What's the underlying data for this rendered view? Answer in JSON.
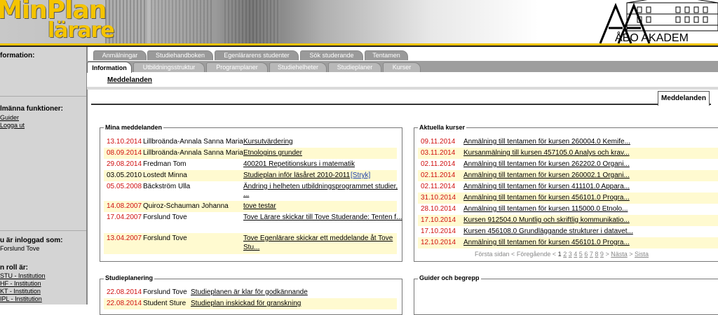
{
  "header": {
    "logo_line1": "MinPlan",
    "logo_line2": "lärare",
    "university": "ÅBO AKADEM"
  },
  "sidebar": {
    "information_heading": "formation:",
    "functions_heading": "lmänna funktioner:",
    "links": [
      "Guider",
      "Logga ut"
    ],
    "logged_in_heading": "u är inloggad som:",
    "logged_in_user": "Forslund Tove",
    "role_heading": "n roll är:",
    "roles": [
      "STU - Institution",
      "HF - Institution",
      "KT - Institution",
      "IPL - Institution"
    ]
  },
  "tabs": {
    "row1": [
      "Anmälningar",
      "Studiehandboken",
      "Egenlärarens studenter",
      "Sök studerande",
      "Tentamen"
    ],
    "row2": [
      "Information",
      "Utbildningsstruktur",
      "Programplaner",
      "Studiehelheter",
      "Studieplaner",
      "Kurser"
    ]
  },
  "subnav": {
    "link": "Meddelanden"
  },
  "meddelanden_tab": "Meddelanden",
  "mina": {
    "legend": "Mina meddelanden",
    "rows": [
      {
        "date": "13.10.2014",
        "name": "Lillbroända-Annala Sanna Maria",
        "msg": "Kursutvärdering",
        "red": true
      },
      {
        "date": "08.09.2014",
        "name": "Lillbroända-Annala Sanna Maria",
        "msg": "Etnologins grunder",
        "red": true
      },
      {
        "date": "29.08.2014",
        "name": "Fredman Tom",
        "msg": "400201 Repetitionskurs i matematik",
        "red": true
      },
      {
        "date": "03.05.2010",
        "name": "Lostedt Minna",
        "msg": "Studieplan inför läsåret 2010-2011",
        "red": false,
        "extra": "[Stryk]"
      },
      {
        "date": "05.05.2008",
        "name": "Bäckström Ulla",
        "msg": "Ändring i helheten utbildningsprogrammet studier,",
        "msg2": "...",
        "red": true
      },
      {
        "date": "14.08.2007",
        "name": "Quiroz-Schauman Johanna",
        "msg": "tove testar",
        "red": true
      },
      {
        "date": "17.04.2007",
        "name": "Forslund Tove",
        "msg": "Tove Lärare skickar till Tove Studerande: Tenten f...",
        "red": true
      },
      {
        "date": "13.04.2007",
        "name": "Forslund Tove",
        "msg": "Tove Egenlärare skickar ett meddelande åt Tove",
        "msg2": "Stu...",
        "red": true
      }
    ]
  },
  "aktuella": {
    "legend": "Aktuella kurser",
    "rows": [
      {
        "date": "09.11.2014",
        "text": "Anmälning till tentamen för kursen 260004.0 Kemife..."
      },
      {
        "date": "03.11.2014",
        "text": "Kursanmälning till kursen 457105.0 Analys och krav..."
      },
      {
        "date": "02.11.2014",
        "text": "Anmälning till tentamen för kursen 262202.0 Organi..."
      },
      {
        "date": "02.11.2014",
        "text": "Anmälning till tentamen för kursen 260002.1 Organi..."
      },
      {
        "date": "02.11.2014",
        "text": "Anmälning till tentamen för kursen 411101.0 Appara..."
      },
      {
        "date": "31.10.2014",
        "text": "Anmälning till tentamen för kursen 456101.0 Progra..."
      },
      {
        "date": "28.10.2014",
        "text": "Anmälning till tentamen för kursen 115000.0 Etnolo..."
      },
      {
        "date": "17.10.2014",
        "text": "Kursen 912504.0 Muntlig och skriftlig kommunikatio..."
      },
      {
        "date": "17.10.2014",
        "text": "Kursen 456108.0 Grundläggande strukturer i datavet..."
      },
      {
        "date": "12.10.2014",
        "text": "Anmälning till tentamen för kursen 456101.0 Progra..."
      }
    ],
    "pager": {
      "first": "Första sidan",
      "prev_arrow": "<",
      "prev": "Föregående",
      "pages": [
        "1",
        "2",
        "3",
        "4",
        "5",
        "6",
        "7",
        "8",
        "9"
      ],
      "next_arrow": ">",
      "next": "Nästa",
      "last_arrow": ">",
      "last": "Sista"
    }
  },
  "studieplanering": {
    "legend": "Studieplanering",
    "rows": [
      {
        "date": "22.08.2014",
        "name": "Forslund Tove",
        "msg": "Studieplanen är klar för godkännande"
      },
      {
        "date": "22.08.2014",
        "name": "Student Sture",
        "msg": "Studieplan inskickad för granskning"
      }
    ]
  },
  "guider": {
    "legend": "Guider och begrepp"
  }
}
